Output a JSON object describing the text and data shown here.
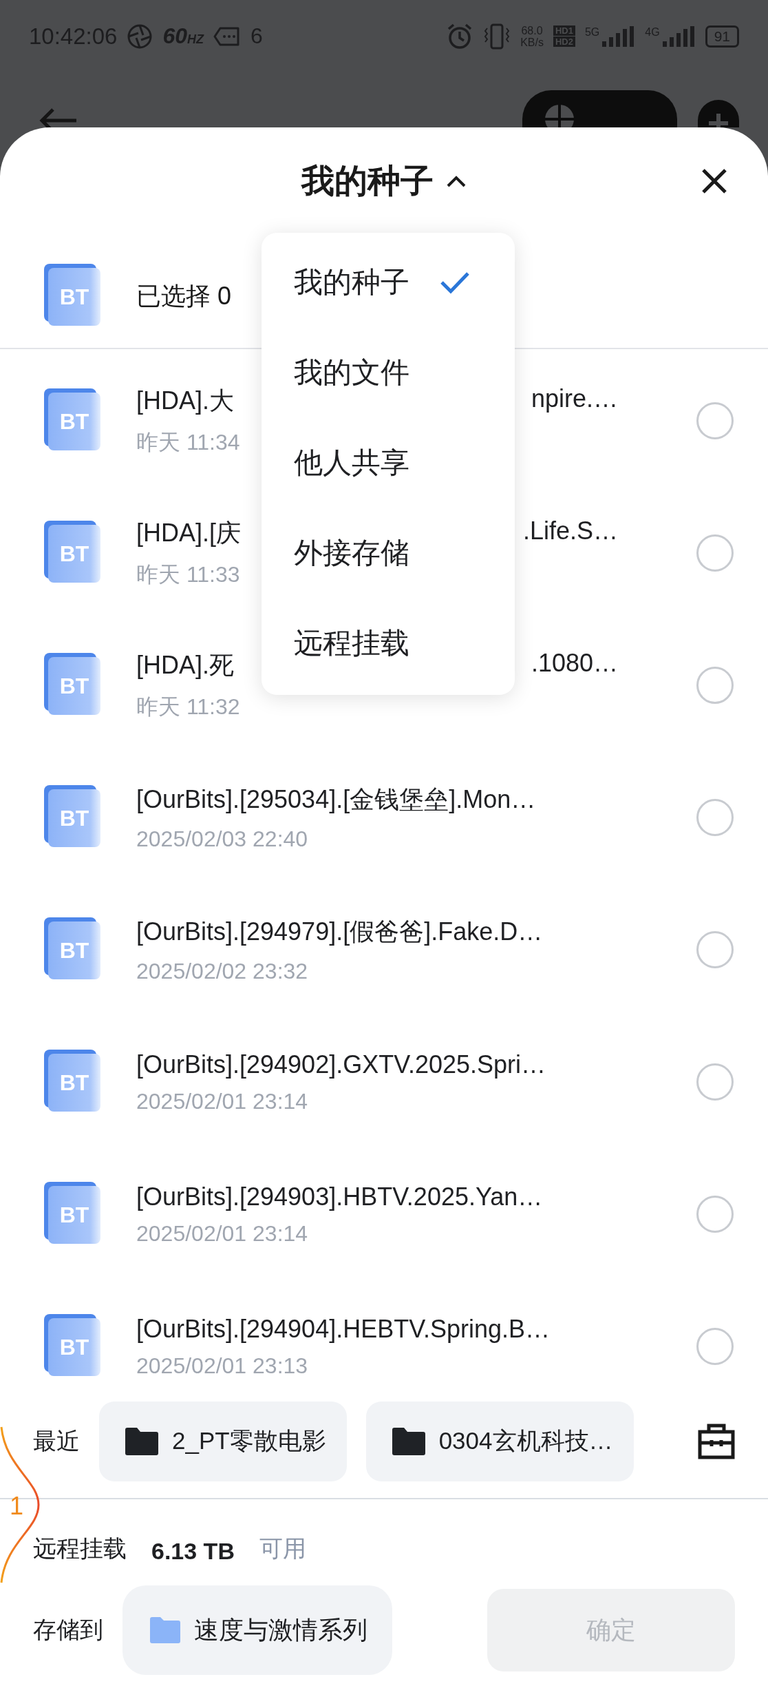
{
  "status_bar": {
    "time": "10:42:06",
    "refresh_rate": "60",
    "refresh_unit": "HZ",
    "notification_count": "6",
    "net_speed": "68.0",
    "net_unit": "KB/s",
    "hd_top": "HD1",
    "hd_bottom": "HD2",
    "sim1": "5G",
    "sim2": "4G",
    "battery": "91"
  },
  "sheet": {
    "title": "我的种子",
    "expanded": true,
    "selection": {
      "badge": "BT",
      "text": "已选择 0"
    },
    "dropdown": [
      {
        "label": "我的种子",
        "selected": true
      },
      {
        "label": "我的文件",
        "selected": false
      },
      {
        "label": "他人共享",
        "selected": false
      },
      {
        "label": "外接存储",
        "selected": false
      },
      {
        "label": "远程挂载",
        "selected": false
      }
    ],
    "files": [
      {
        "badge": "BT",
        "title": "[HDA].大",
        "title_tail": "npire.…",
        "time": "昨天 11:34",
        "selected": false
      },
      {
        "badge": "BT",
        "title": "[HDA].[庆",
        "title_tail": ".Life.S…",
        "time": "昨天 11:33",
        "selected": false
      },
      {
        "badge": "BT",
        "title": "[HDA].死",
        "title_tail": ".1080…",
        "time": "昨天 11:32",
        "selected": false
      },
      {
        "badge": "BT",
        "title": "[OurBits].[295034].[金钱堡垒].Mon…",
        "time": "2025/02/03 22:40",
        "selected": false
      },
      {
        "badge": "BT",
        "title": "[OurBits].[294979].[假爸爸].Fake.D…",
        "time": "2025/02/02 23:32",
        "selected": false
      },
      {
        "badge": "BT",
        "title": "[OurBits].[294902].GXTV.2025.Spri…",
        "time": "2025/02/01 23:14",
        "selected": false
      },
      {
        "badge": "BT",
        "title": "[OurBits].[294903].HBTV.2025.Yan…",
        "time": "2025/02/01 23:14",
        "selected": false
      },
      {
        "badge": "BT",
        "title": "[OurBits].[294904].HEBTV.Spring.B…",
        "time": "2025/02/01 23:13",
        "selected": false
      }
    ],
    "recent": {
      "label": "最近",
      "folders": [
        "2_PT零散电影",
        "0304玄机科技…"
      ]
    },
    "storage": {
      "label": "远程挂载",
      "size": "6.13 TB",
      "note": "可用"
    },
    "save_to": {
      "label": "存储到",
      "folder": "速度与激情系列",
      "confirm": "确定",
      "confirm_disabled": true
    }
  },
  "edge_indicator": {
    "count": "1"
  }
}
